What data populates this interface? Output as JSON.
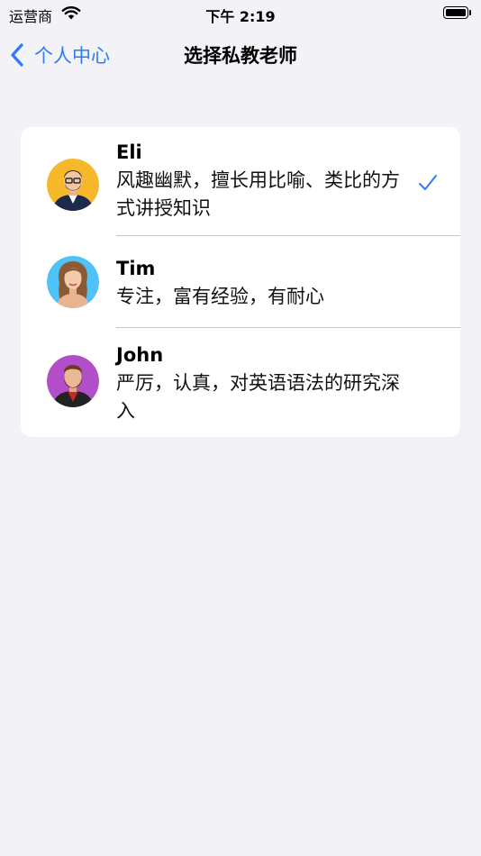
{
  "status_bar": {
    "carrier": "运营商",
    "time": "下午 2:19"
  },
  "nav": {
    "back_label": "个人中心",
    "title": "选择私教老师"
  },
  "teachers": [
    {
      "name": "Eli",
      "description": "风趣幽默，擅长用比喻、类比的方式讲授知识",
      "selected": true,
      "avatar_color": "#f6b92b"
    },
    {
      "name": "Tim",
      "description": "专注，富有经验，有耐心",
      "selected": false,
      "avatar_color": "#4fc3f7"
    },
    {
      "name": "John",
      "description": "严厉，认真，对英语语法的研究深入",
      "selected": false,
      "avatar_color": "#b24fc8"
    }
  ],
  "colors": {
    "accent": "#2f7bf6",
    "background": "#f2f2f7",
    "card": "#ffffff",
    "divider": "#c6c6c8"
  }
}
